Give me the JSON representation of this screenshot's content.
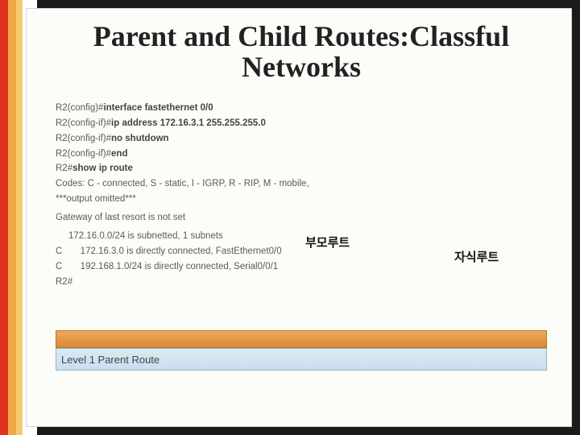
{
  "title": "Parent and Child Routes:Classful Networks",
  "term": {
    "l1_p": "R2(config)#",
    "l1_c": "interface fastethernet 0/0",
    "l2_p": "R2(config-if)#",
    "l2_c": "ip address 172.16.3.1 255.255.255.0",
    "l3_p": "R2(config-if)#",
    "l3_c": "no shutdown",
    "l4_p": "R2(config-if)#",
    "l4_c": "end",
    "l5_p": "R2#",
    "l5_c": "show ip route",
    "l6": "Codes: C - connected, S - static, I - IGRP, R - RIP, M - mobile,",
    "l7": "***output omitted***",
    "l8": "Gateway of last resort is not set",
    "l9": "     172.16.0.0/24 is subnetted, 1 subnets",
    "l10": "C       172.16.3.0 is directly connected, FastEthernet0/0",
    "l11": "C       192.168.1.0/24 is directly connected, Serial0/0/1",
    "l12": "R2#"
  },
  "annotations": {
    "parent": "부모루트",
    "child": "자식루트"
  },
  "bands": {
    "level1_label": "Level 1 Parent Route"
  },
  "chart_data": {
    "type": "table",
    "title": "Parent and Child Routes: Classful Networks",
    "rows": [
      [
        "R2(config)#",
        "interface fastethernet 0/0"
      ],
      [
        "R2(config-if)#",
        "ip address 172.16.3.1 255.255.255.0"
      ],
      [
        "R2(config-if)#",
        "no shutdown"
      ],
      [
        "R2(config-if)#",
        "end"
      ],
      [
        "R2#",
        "show ip route"
      ],
      [
        "",
        "Codes: C - connected, S - static, I - IGRP, R - RIP, M - mobile,"
      ],
      [
        "",
        "***output omitted***"
      ],
      [
        "",
        "Gateway of last resort is not set"
      ],
      [
        "",
        "172.16.0.0/24 is subnetted, 1 subnets"
      ],
      [
        "C",
        "172.16.3.0 is directly connected, FastEthernet0/0"
      ],
      [
        "C",
        "192.168.1.0/24 is directly connected, Serial0/0/1"
      ],
      [
        "R2#",
        ""
      ]
    ],
    "annotations": {
      "parent_route_label": "부모루트",
      "child_route_label": "자식루트",
      "band_label": "Level 1 Parent Route"
    }
  }
}
